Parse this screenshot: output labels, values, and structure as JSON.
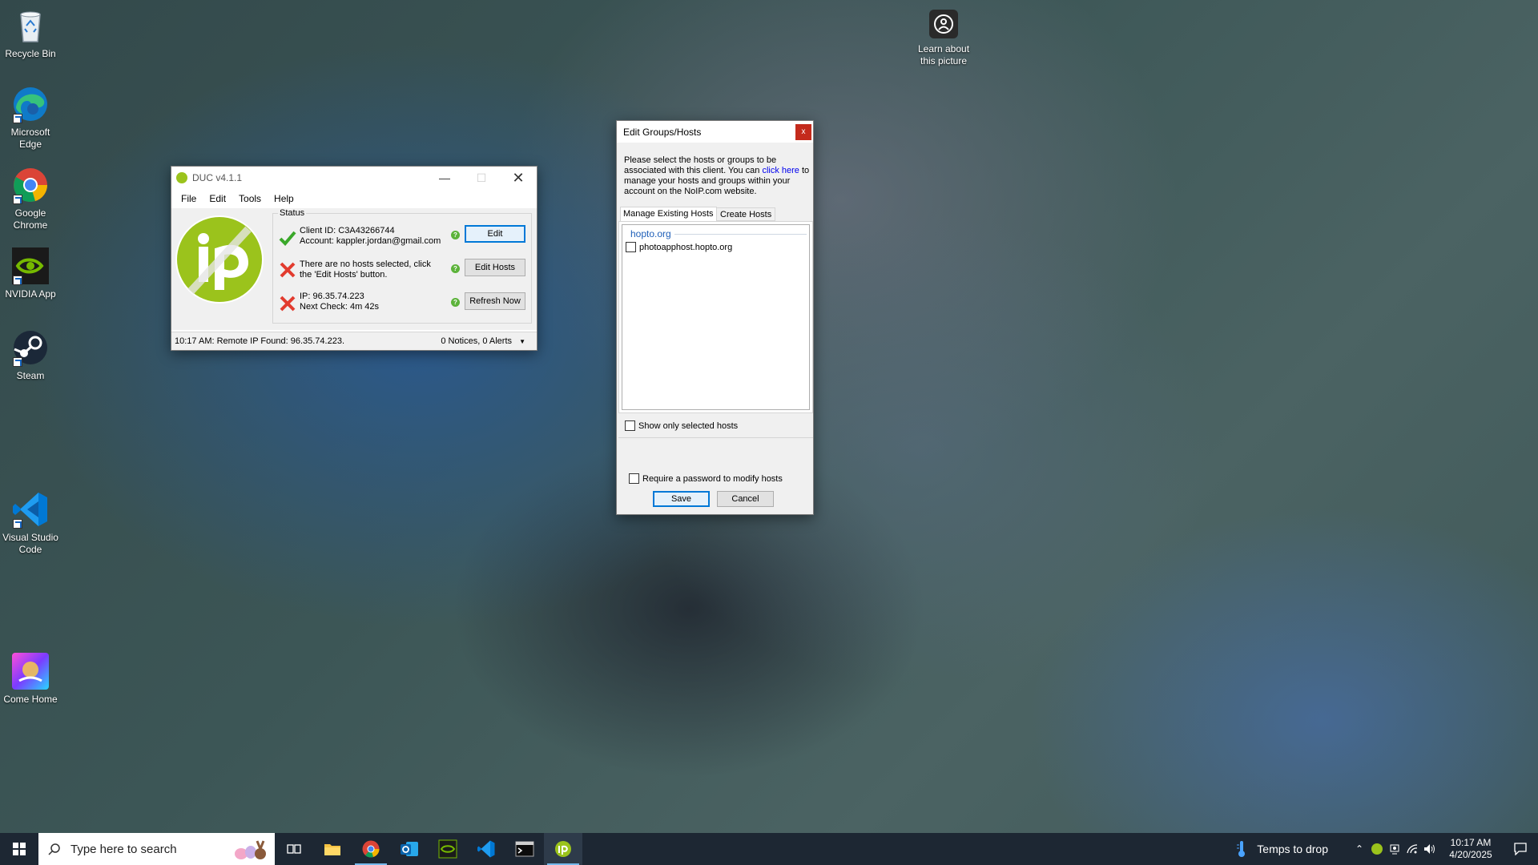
{
  "desktop": {
    "icons": [
      {
        "label": "Recycle Bin"
      },
      {
        "label": "Microsoft Edge"
      },
      {
        "label": "Google Chrome"
      },
      {
        "label": "NVIDIA App"
      },
      {
        "label": "Steam"
      },
      {
        "label": "Visual Studio Code"
      },
      {
        "label": "Come Home"
      }
    ],
    "learn_picture": "Learn about this picture"
  },
  "duc": {
    "title": "DUC v4.1.1",
    "menu": [
      "File",
      "Edit",
      "Tools",
      "Help"
    ],
    "status_group": "Status",
    "rows": [
      {
        "line1": "Client ID: C3A43266744",
        "line2": "Account: kappler.jordan@gmail.com",
        "button": "Edit",
        "ok": true
      },
      {
        "line1": "There are no hosts selected, click",
        "line2": "the 'Edit Hosts' button.",
        "button": "Edit Hosts",
        "ok": false
      },
      {
        "line1": "IP: 96.35.74.223",
        "line2": "Next Check: 4m 42s",
        "button": "Refresh Now",
        "ok": false
      }
    ],
    "statusbar": "10:17 AM: Remote IP Found: 96.35.74.223.",
    "notices": "0 Notices, 0 Alerts",
    "logo_color": "#9bc31c"
  },
  "edit_dialog": {
    "title": "Edit Groups/Hosts",
    "close": "x",
    "intro_before_link": "Please select the hosts or groups to be associated with this client. You can ",
    "intro_link": "click here",
    "intro_after_link": " to manage your hosts and groups within your account on the NoIP.com website.",
    "tabs": [
      "Manage Existing Hosts",
      "Create Hosts"
    ],
    "group_name": "hopto.org",
    "hosts": [
      "photoapphost.hopto.org"
    ],
    "show_selected": "Show only selected hosts",
    "require_password": "Require a password to modify hosts",
    "save": "Save",
    "cancel": "Cancel"
  },
  "taskbar": {
    "search_placeholder": "Type here to search",
    "weather": "Temps to drop",
    "time": "10:17 AM",
    "date": "4/20/2025"
  }
}
